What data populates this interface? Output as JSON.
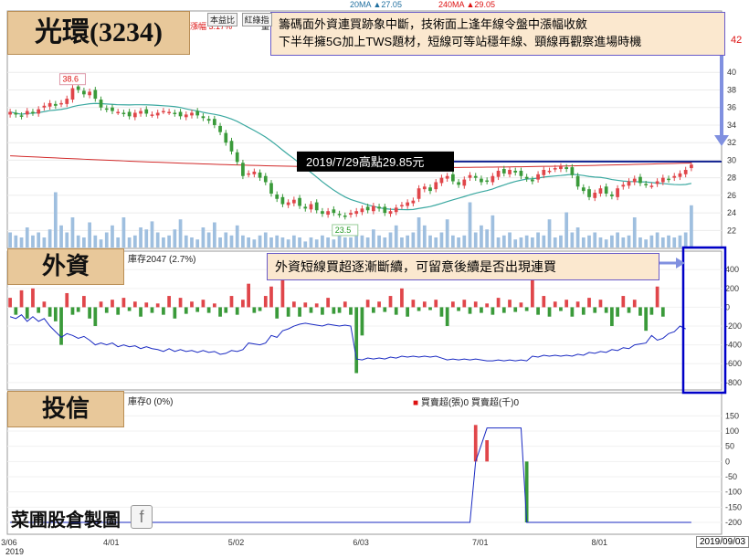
{
  "labels": {
    "main_title": "光環(3234)",
    "foreign_title": "外資",
    "trust_title": "投信",
    "note_top_line1": "籌碼面外資連買跡象中斷，技術面上逢年線令盤中漲幅收斂",
    "note_top_line2": "下半年擁5G加上TWS題材，短線可等站穩年線、頸線再觀察進場時機",
    "high_label": "2019/7/29高點29.85元",
    "note_foreign": "外資短線買超逐漸斷續，可留意後續是否出現連買",
    "ma20": "20MA ▲27.05",
    "ma240": "240MA ▲29.05",
    "change_text": "漲幅 3.17%",
    "change_prefix": "量",
    "tabs": [
      "本益比",
      "紅綠指"
    ],
    "last_price_fragment": "42",
    "foreign_stock_text": "庫存2047 (2.7%)",
    "trust_stock_text": "庫存0 (0%)",
    "trust_legend": "買賣超(張)0 買賣超(千)0",
    "watermark": "菜圃股倉製圖",
    "fb_icon_glyph": "f",
    "date_badge": "2019/09/03",
    "year": "2019",
    "annotation_high_tick": "38.6",
    "annotation_low_tick": "23.5"
  },
  "colors": {
    "up": "#e0464a",
    "down": "#3a9a3a",
    "ma20": "#3aa8a0",
    "ma240": "#d22a2a",
    "volume": "#9fbfdf",
    "line_price": "#1a2ac2",
    "highlight_box": "#0000c8",
    "neckline": "#102090"
  },
  "chart_data": [
    {
      "type": "candlestick",
      "title": "光環(3234)",
      "ylim": [
        21,
        42
      ],
      "yticks": [
        22,
        24,
        26,
        28,
        30,
        32,
        34,
        36,
        38,
        40
      ],
      "x_ticks": [
        "3/06",
        "4/01",
        "5/02",
        "6/03",
        "7/01",
        "8/01"
      ],
      "ohlc_close_series": [
        35.5,
        35.2,
        35.0,
        35.6,
        35.4,
        35.8,
        36.2,
        36.5,
        36.2,
        36.5,
        37.0,
        38.2,
        38.0,
        37.5,
        37.8,
        37.0,
        36.0,
        35.8,
        35.6,
        35.5,
        35.3,
        35.0,
        35.4,
        35.6,
        35.3,
        35.2,
        35.4,
        35.6,
        35.5,
        35.3,
        35.0,
        35.2,
        35.4,
        35.1,
        34.8,
        34.5,
        34.0,
        33.2,
        32.0,
        31.0,
        29.8,
        28.2,
        28.5,
        28.7,
        28.0,
        27.5,
        26.2,
        25.6,
        25.0,
        25.2,
        25.5,
        24.8,
        24.5,
        25.0,
        24.3,
        23.9,
        24.2,
        24.0,
        23.8,
        23.6,
        24.0,
        24.2,
        24.5,
        24.3,
        24.8,
        24.5,
        24.0,
        24.2,
        24.6,
        24.9,
        25.2,
        25.4,
        26.8,
        27.0,
        26.5,
        27.5,
        28.0,
        28.2,
        27.6,
        27.2,
        27.8,
        28.3,
        28.0,
        27.5,
        27.6,
        28.2,
        28.8,
        28.5,
        28.9,
        28.6,
        28.2,
        27.9,
        27.6,
        28.4,
        28.9,
        28.8,
        29.1,
        29.3,
        29.0,
        28.3,
        27.0,
        26.5,
        25.8,
        26.3,
        26.8,
        26.2,
        25.9,
        26.8,
        27.2,
        27.6,
        27.9,
        27.4,
        27.2,
        27.1,
        27.6,
        28.0,
        27.8,
        28.2,
        28.5,
        28.9,
        29.5
      ],
      "high_annotation": {
        "value": 38.6,
        "label": "38.6"
      },
      "low_annotation": {
        "value": 23.5,
        "label": "23.5"
      },
      "neckline_value": 29.85,
      "ma20": {
        "name": "20MA",
        "last": 27.05
      },
      "ma240": {
        "name": "240MA",
        "last": 29.05
      },
      "volume_relative": [
        0.15,
        0.12,
        0.1,
        0.2,
        0.12,
        0.15,
        0.1,
        0.18,
        0.55,
        0.22,
        0.15,
        0.3,
        0.12,
        0.1,
        0.25,
        0.12,
        0.08,
        0.15,
        0.22,
        0.1,
        0.3,
        0.1,
        0.12,
        0.2,
        0.18,
        0.26,
        0.15,
        0.1,
        0.12,
        0.18,
        0.28,
        0.12,
        0.1,
        0.08,
        0.2,
        0.15,
        0.25,
        0.1,
        0.15,
        0.12,
        0.22,
        0.12,
        0.1,
        0.08,
        0.12,
        0.15,
        0.1,
        0.12,
        0.1,
        0.08,
        0.12,
        0.1,
        0.06,
        0.1,
        0.08,
        0.12,
        0.1,
        0.08,
        0.12,
        0.1,
        0.1,
        0.15,
        0.12,
        0.1,
        0.18,
        0.12,
        0.1,
        0.15,
        0.22,
        0.1,
        0.12,
        0.15,
        0.3,
        0.22,
        0.12,
        0.1,
        0.15,
        0.28,
        0.12,
        0.1,
        0.12,
        0.45,
        0.15,
        0.22,
        0.18,
        0.32,
        0.1,
        0.12,
        0.15,
        0.08,
        0.1,
        0.12,
        0.1,
        0.15,
        0.12,
        0.28,
        0.1,
        0.12,
        0.35,
        0.15,
        0.2,
        0.1,
        0.12,
        0.15,
        0.1,
        0.08,
        0.12,
        0.15,
        0.1,
        0.12,
        0.3,
        0.1,
        0.08,
        0.12,
        0.15,
        0.1,
        0.12,
        0.1,
        0.12,
        0.15,
        0.42
      ]
    },
    {
      "type": "bar",
      "title": "外資",
      "ylabel": "",
      "ylim": [
        -850,
        470
      ],
      "yticks": [
        -800,
        -600,
        -400,
        -200,
        0,
        200,
        400
      ],
      "net_buy_series": [
        100,
        -80,
        180,
        -120,
        200,
        -60,
        60,
        -100,
        -150,
        -400,
        150,
        -80,
        -50,
        120,
        -120,
        -200,
        60,
        -60,
        80,
        -80,
        100,
        -40,
        60,
        -100,
        50,
        -60,
        40,
        -80,
        120,
        -120,
        100,
        -70,
        60,
        -50,
        80,
        -60,
        40,
        -100,
        -60,
        120,
        -80,
        80,
        250,
        -60,
        -40,
        120,
        220,
        -120,
        350,
        -100,
        60,
        -100,
        50,
        -60,
        40,
        -80,
        100,
        -70,
        -60,
        60,
        -80,
        -700,
        -300,
        80,
        -60,
        60,
        -50,
        120,
        -80,
        200,
        -100,
        80,
        -40,
        60,
        -30,
        80,
        -100,
        -200,
        60,
        -40,
        80,
        -70,
        60,
        -60,
        40,
        -80,
        100,
        -60,
        80,
        -50,
        50,
        -40,
        300,
        -80,
        120,
        -100,
        60,
        -40,
        80,
        -100,
        60,
        -80,
        100,
        -60,
        80,
        -60,
        -200,
        -100,
        120,
        -60,
        80,
        -90,
        -250,
        -80,
        220,
        -100
      ],
      "cumulative_line": [
        -100,
        -120,
        -80,
        -150,
        -100,
        -150,
        -120,
        -200,
        -260,
        -320,
        -280,
        -300,
        -330,
        -310,
        -350,
        -400,
        -380,
        -400,
        -380,
        -420,
        -400,
        -420,
        -410,
        -440,
        -420,
        -440,
        -450,
        -470,
        -440,
        -470,
        -450,
        -470,
        -460,
        -480,
        -460,
        -480,
        -470,
        -500,
        -490,
        -460,
        -470,
        -450,
        -380,
        -390,
        -400,
        -380,
        -300,
        -320,
        -250,
        -230,
        -200,
        -180,
        -170,
        -180,
        -190,
        -200,
        -180,
        -190,
        -200,
        -190,
        -200,
        -550,
        -560,
        -540,
        -550,
        -540,
        -550,
        -530,
        -540,
        -520,
        -530,
        -520,
        -530,
        -520,
        -530,
        -520,
        -540,
        -560,
        -550,
        -560,
        -550,
        -560,
        -550,
        -560,
        -570,
        -570,
        -560,
        -570,
        -560,
        -570,
        -560,
        -570,
        -520,
        -530,
        -510,
        -520,
        -510,
        -520,
        -510,
        -520,
        -500,
        -510,
        -480,
        -490,
        -470,
        -480,
        -450,
        -460,
        -430,
        -440,
        -400,
        -390,
        -380,
        -300,
        -350,
        -330,
        -280,
        -260,
        -200,
        -230
      ]
    },
    {
      "type": "bar",
      "title": "投信",
      "ylim": [
        -230,
        160
      ],
      "yticks": [
        -200,
        -150,
        -100,
        -50,
        0,
        50,
        100,
        150
      ],
      "net_buy_events": [
        {
          "index": 82,
          "value": 120
        },
        {
          "index": 84,
          "value": 70
        },
        {
          "index": 91,
          "value": -200
        }
      ],
      "cumulative_line_points": [
        {
          "index": 0,
          "value": -200
        },
        {
          "index": 81,
          "value": -200
        },
        {
          "index": 82,
          "value": 0
        },
        {
          "index": 84,
          "value": 110
        },
        {
          "index": 90,
          "value": 110
        },
        {
          "index": 91,
          "value": -200
        },
        {
          "index": 120,
          "value": -200
        }
      ]
    }
  ]
}
